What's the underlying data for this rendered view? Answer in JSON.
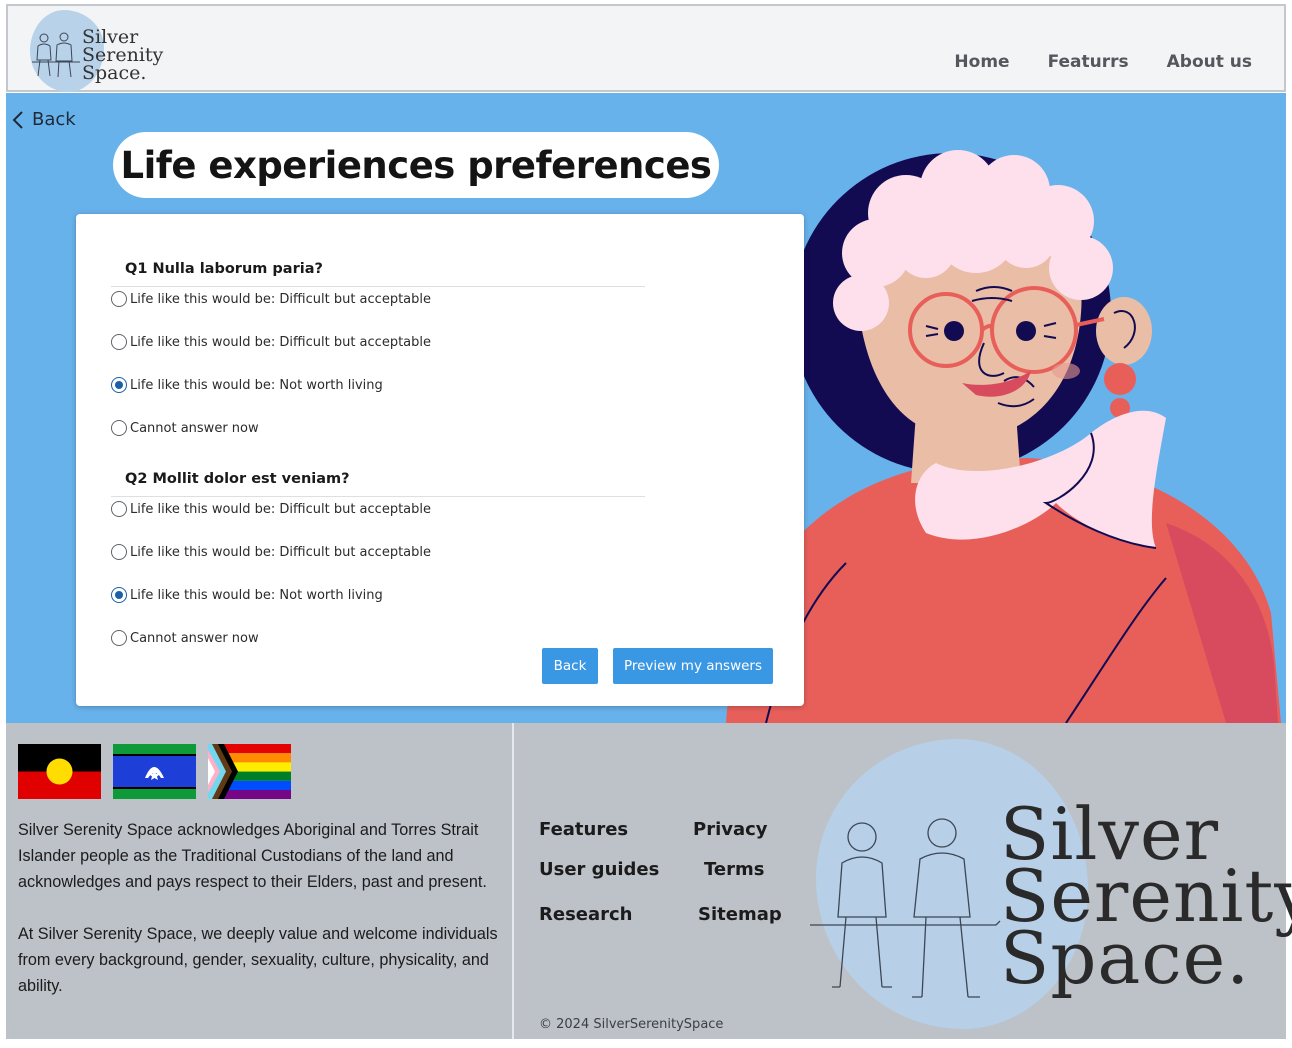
{
  "header": {
    "logo_text": [
      "Silver",
      "Serenity",
      "Space."
    ],
    "nav": [
      "Home",
      "Featurrs",
      "About us"
    ]
  },
  "hero": {
    "back_label": "Back",
    "title": "Life experiences preferences"
  },
  "questions": [
    {
      "title": "Q1 Nulla laborum paria?",
      "options": [
        {
          "label": "Life like this would be: Difficult but acceptable",
          "selected": false
        },
        {
          "label": "Life like this would be:  Difficult but acceptable",
          "selected": false
        },
        {
          "label": "Life like this would be:  Not worth living",
          "selected": true
        },
        {
          "label": "Cannot answer now",
          "selected": false
        }
      ]
    },
    {
      "title": "Q2 Mollit dolor est veniam?",
      "options": [
        {
          "label": "Life like this would be: Difficult but acceptable",
          "selected": false
        },
        {
          "label": "Life like this would be:  Difficult but acceptable",
          "selected": false
        },
        {
          "label": "Life like this would be:  Not worth living",
          "selected": true
        },
        {
          "label": "Cannot answer now",
          "selected": false
        }
      ]
    }
  ],
  "form_buttons": {
    "back": "Back",
    "preview": "Preview my answers"
  },
  "footer": {
    "acknowledgement": "Silver Serenity Space acknowledges Aboriginal and Torres Strait\nIslander people as the Traditional Custodians of the land  and\nacknowledges and pays respect to their Elders, past and present.\n\nAt Silver Serenity Space, we deeply value and welcome individuals\nfrom every background, gender, sexuality, culture, physicality, and\nability.",
    "links": {
      "features": "Features",
      "privacy": "Privacy",
      "user_guides": "User guides",
      "terms": "Terms",
      "research": "Research",
      "sitemap": "Sitemap"
    },
    "copyright": "© 2024 SilverSerenitySpace",
    "logo_text": [
      "Silver",
      "Serenity",
      "Space."
    ]
  },
  "colors": {
    "hero_bg": "#68b2ec",
    "button": "#3a97e3",
    "footer_bg": "#bdc1c8",
    "radio_selected": "#1a5fa8"
  },
  "icons": [
    "chevron-left-icon",
    "couple-illustration",
    "grandma-illustration",
    "aboriginal-flag",
    "torres-strait-flag",
    "progress-pride-flag"
  ]
}
